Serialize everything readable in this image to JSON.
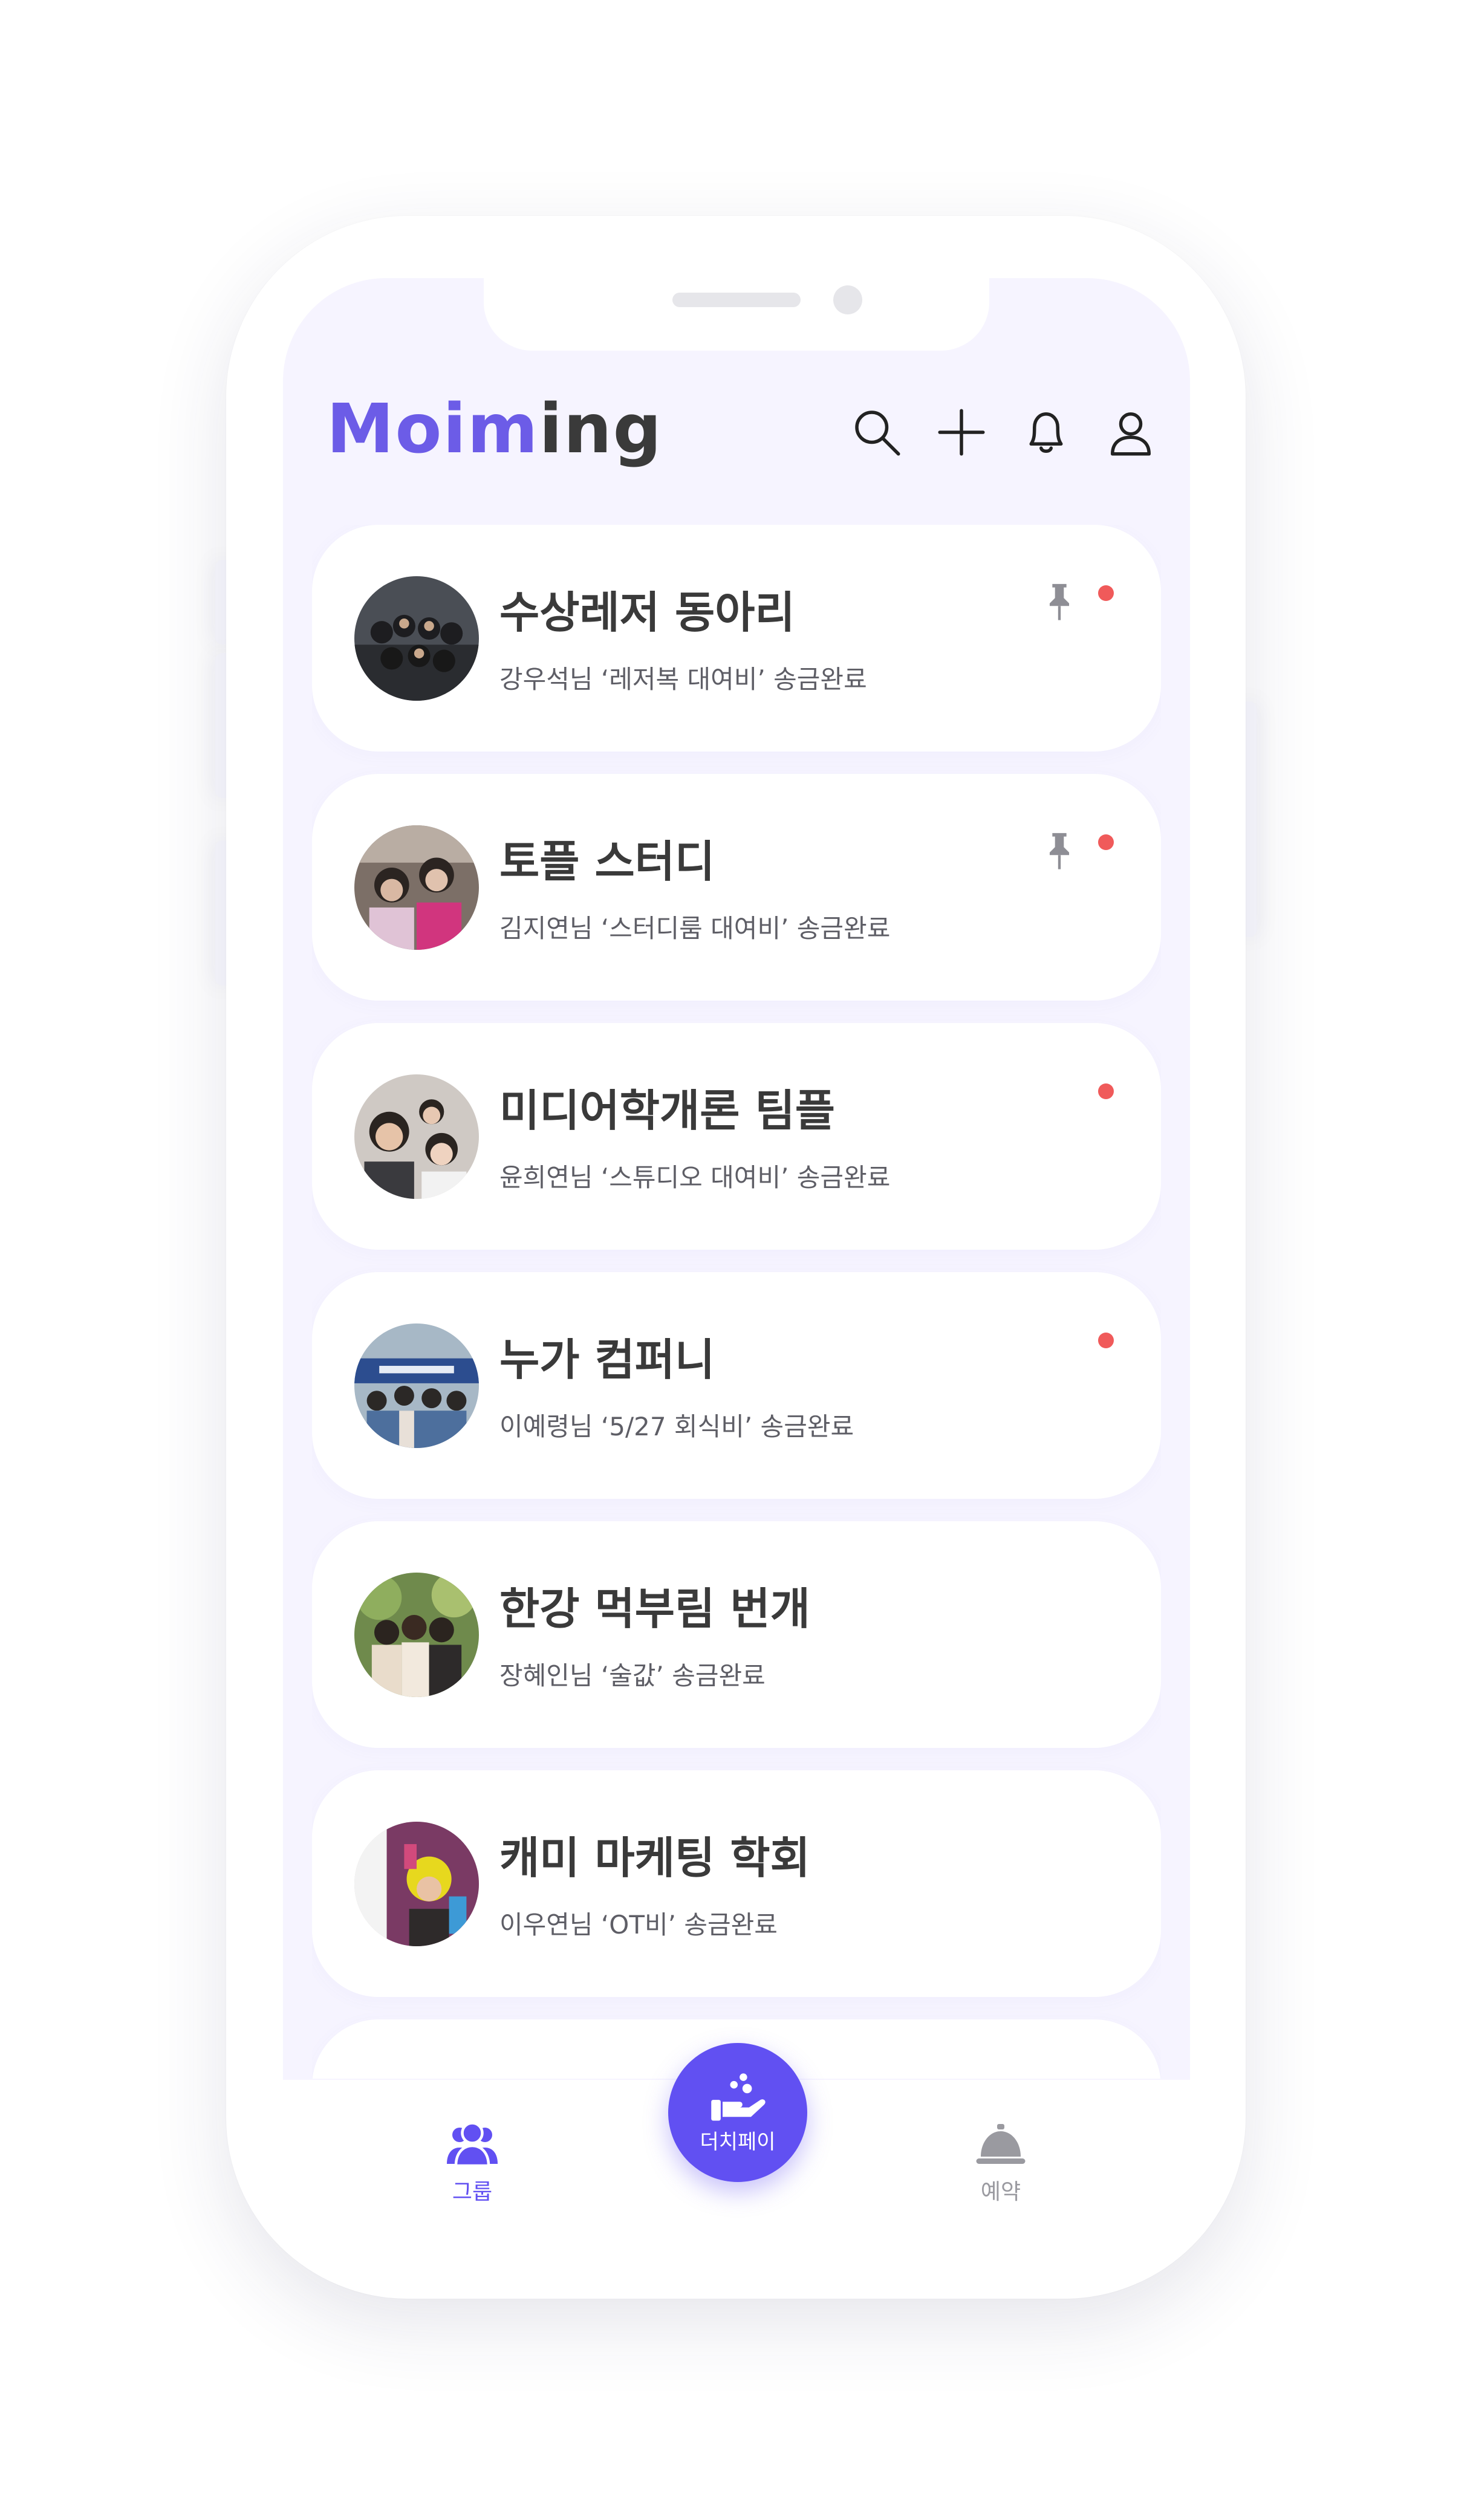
{
  "app": {
    "logo_part1": "Moim",
    "logo_part2": "ing"
  },
  "header_icons": [
    "search-icon",
    "plus-icon",
    "bell-icon",
    "user-icon"
  ],
  "colors": {
    "accent": "#6150f2",
    "logo_accent": "#6c5ce7",
    "screen_bg": "#f6f4ff",
    "unread_dot": "#f05a5a",
    "text_dark": "#3a3a3a",
    "nav_inactive": "#9a9aa0"
  },
  "groups": [
    {
      "name": "수상레저 동아리",
      "last_activity": "강우석님 ‘레저복 대여비’ 송금완료",
      "pinned": true,
      "unread": true
    },
    {
      "name": "토플 스터디",
      "last_activity": "김지연님 ‘스터디룸 대여비’ 송금완료",
      "pinned": true,
      "unread": true
    },
    {
      "name": "미디어학개론 팀플",
      "last_activity": "윤희연님 ‘스튜디오 대여비’ 송금완료",
      "pinned": false,
      "unread": true
    },
    {
      "name": "누가 컴퍼니",
      "last_activity": "이예령님 ‘5/27 회식비’ 송금완료",
      "pinned": false,
      "unread": true
    },
    {
      "name": "한강 먹부림 번개",
      "last_activity": "장혜인님 ‘술값’ 송금완료",
      "pinned": false,
      "unread": false
    },
    {
      "name": "캐미 마케팅 학회",
      "last_activity": "이우연님 ‘OT비’ 송금완료",
      "pinned": false,
      "unread": false
    }
  ],
  "bottom_nav": {
    "groups_label": "그룹",
    "pay_label": "더치페이",
    "reservation_label": "예약",
    "active": "groups"
  }
}
